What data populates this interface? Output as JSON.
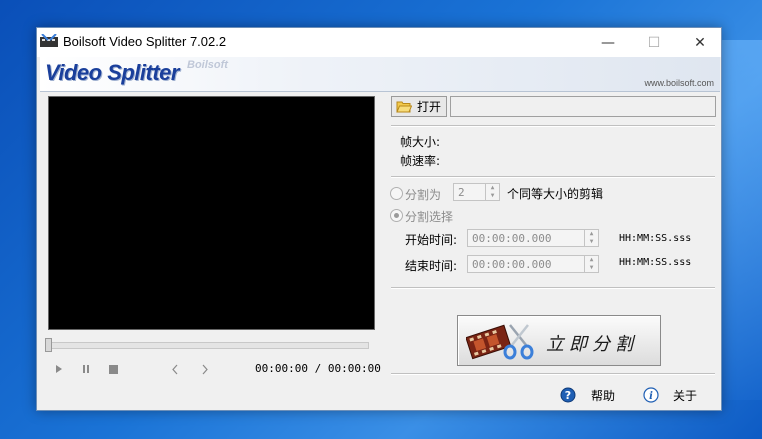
{
  "window": {
    "title": "Boilsoft Video Splitter 7.02.2",
    "minimize_glyph": "—",
    "maximize_glyph": "☐",
    "close_glyph": "✕"
  },
  "banner": {
    "logo_text": "Video Splitter",
    "brand_text": "Boilsoft",
    "url": "www.boilsoft.com"
  },
  "player": {
    "time_current": "00:00:00",
    "time_separator": "/",
    "time_total": "00:00:00",
    "seek_fraction": 0.0,
    "icons": [
      "play-icon",
      "pause-icon",
      "stop-icon",
      "mark-start-icon",
      "mark-end-icon"
    ]
  },
  "file": {
    "open_label": "打开",
    "path_value": ""
  },
  "info": {
    "frame_size_label": "帧大小:",
    "frame_rate_label": "帧速率:"
  },
  "split_mode": {
    "equal_label": "分割为",
    "equal_count": "2",
    "equal_suffix": "个同等大小的剪辑",
    "select_label": "分割选择",
    "start_label": "开始时间:",
    "start_value": "00:00:00.000",
    "end_label": "结束时间:",
    "end_value": "00:00:00.000",
    "format_hint": "HH:MM:SS.sss"
  },
  "actions": {
    "split_now_label": "立即分割",
    "help_label": "帮助",
    "about_label": "关于"
  },
  "colors": {
    "logo_blue": "#1a3f9b",
    "help_icon_blue": "#1f5fb4",
    "film_red": "#8b2a1a",
    "scissors_blue": "#3b7fd9"
  }
}
